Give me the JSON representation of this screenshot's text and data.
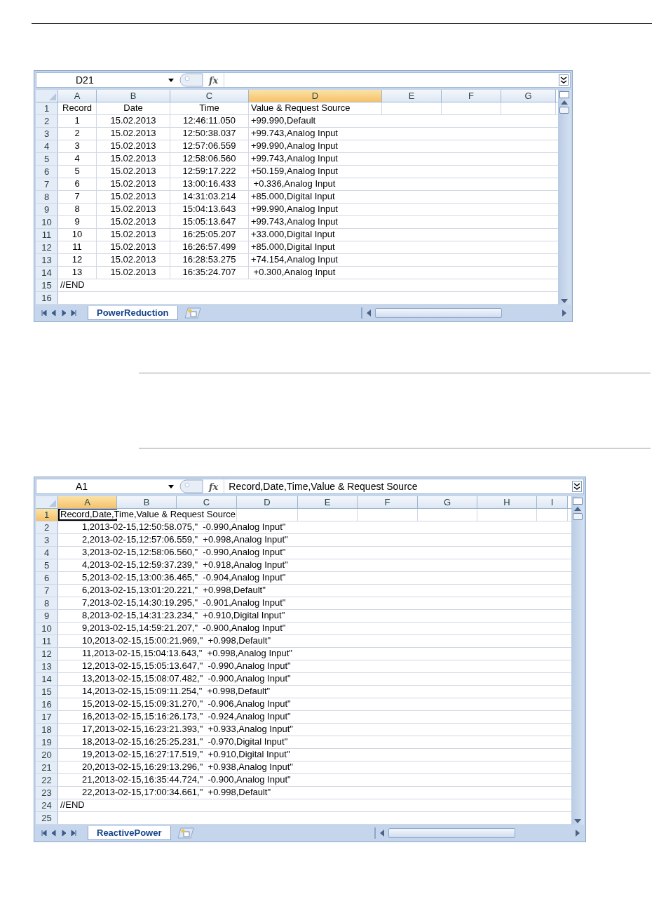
{
  "sheets": [
    {
      "name_box": "D21",
      "function_button": "fx",
      "tab": "PowerReduction",
      "columns": [
        {
          "label": "A",
          "selected": false
        },
        {
          "label": "B",
          "selected": false
        },
        {
          "label": "C",
          "selected": false
        },
        {
          "label": "D",
          "selected": true
        },
        {
          "label": "E",
          "selected": false
        },
        {
          "label": "F",
          "selected": false
        },
        {
          "label": "G",
          "selected": false
        }
      ],
      "rows": [
        {
          "number": "1",
          "kind": "header",
          "selected": false,
          "cells": [
            "Record",
            "Date",
            "Time",
            "Value & Request Source"
          ]
        },
        {
          "number": "2",
          "kind": "data",
          "selected": false,
          "cells": [
            "1",
            "15.02.2013",
            "12:46:11.050",
            "+99.990,Default"
          ]
        },
        {
          "number": "3",
          "kind": "data",
          "selected": false,
          "cells": [
            "2",
            "15.02.2013",
            "12:50:38.037",
            "+99.743,Analog Input"
          ]
        },
        {
          "number": "4",
          "kind": "data",
          "selected": false,
          "cells": [
            "3",
            "15.02.2013",
            "12:57:06.559",
            "+99.990,Analog Input"
          ]
        },
        {
          "number": "5",
          "kind": "data",
          "selected": false,
          "cells": [
            "4",
            "15.02.2013",
            "12:58:06.560",
            "+99.743,Analog Input"
          ]
        },
        {
          "number": "6",
          "kind": "data",
          "selected": false,
          "cells": [
            "5",
            "15.02.2013",
            "12:59:17.222",
            "+50.159,Analog Input"
          ]
        },
        {
          "number": "7",
          "kind": "data",
          "selected": false,
          "cells": [
            "6",
            "15.02.2013",
            "13:00:16.433",
            " +0.336,Analog Input"
          ]
        },
        {
          "number": "8",
          "kind": "data",
          "selected": false,
          "cells": [
            "7",
            "15.02.2013",
            "14:31:03.214",
            "+85.000,Digital Input"
          ]
        },
        {
          "number": "9",
          "kind": "data",
          "selected": false,
          "cells": [
            "8",
            "15.02.2013",
            "15:04:13.643",
            "+99.990,Analog Input"
          ]
        },
        {
          "number": "10",
          "kind": "data",
          "selected": false,
          "cells": [
            "9",
            "15.02.2013",
            "15:05:13.647",
            "+99.743,Analog Input"
          ]
        },
        {
          "number": "11",
          "kind": "data",
          "selected": false,
          "cells": [
            "10",
            "15.02.2013",
            "16:25:05.207",
            "+33.000,Digital Input"
          ]
        },
        {
          "number": "12",
          "kind": "data",
          "selected": false,
          "cells": [
            "11",
            "15.02.2013",
            "16:26:57.499",
            "+85.000,Digital Input"
          ]
        },
        {
          "number": "13",
          "kind": "data",
          "selected": false,
          "cells": [
            "12",
            "15.02.2013",
            "16:28:53.275",
            "+74.154,Analog Input"
          ]
        },
        {
          "number": "14",
          "kind": "data",
          "selected": false,
          "cells": [
            "13",
            "15.02.2013",
            "16:35:24.707",
            " +0.300,Analog Input"
          ]
        },
        {
          "number": "15",
          "kind": "marker",
          "selected": false,
          "cells": [
            "//END"
          ]
        },
        {
          "number": "16",
          "kind": "empty",
          "selected": false,
          "cells": []
        }
      ]
    },
    {
      "name_box": "A1",
      "function_button": "fx",
      "formula": "Record,Date,Time,Value & Request Source",
      "tab": "ReactivePower",
      "columns": [
        {
          "label": "A",
          "selected": true
        },
        {
          "label": "B",
          "selected": false
        },
        {
          "label": "C",
          "selected": false
        },
        {
          "label": "D",
          "selected": false
        },
        {
          "label": "E",
          "selected": false
        },
        {
          "label": "F",
          "selected": false
        },
        {
          "label": "G",
          "selected": false
        },
        {
          "label": "H",
          "selected": false
        },
        {
          "label": "I",
          "selected": false
        }
      ],
      "rows": [
        {
          "number": "1",
          "kind": "header",
          "selected": true,
          "cells": [
            "Record,Date,Time,Value & Request Source"
          ]
        },
        {
          "number": "2",
          "kind": "data",
          "selected": false,
          "cells": [
            "1,2013-02-15,12:50:58.075,\"  -0.990,Analog Input\""
          ]
        },
        {
          "number": "3",
          "kind": "data",
          "selected": false,
          "cells": [
            "2,2013-02-15,12:57:06.559,\"  +0.998,Analog Input\""
          ]
        },
        {
          "number": "4",
          "kind": "data",
          "selected": false,
          "cells": [
            "3,2013-02-15,12:58:06.560,\"  -0.990,Analog Input\""
          ]
        },
        {
          "number": "5",
          "kind": "data",
          "selected": false,
          "cells": [
            "4,2013-02-15,12:59:37.239,\"  +0.918,Analog Input\""
          ]
        },
        {
          "number": "6",
          "kind": "data",
          "selected": false,
          "cells": [
            "5,2013-02-15,13:00:36.465,\"  -0.904,Analog Input\""
          ]
        },
        {
          "number": "7",
          "kind": "data",
          "selected": false,
          "cells": [
            "6,2013-02-15,13:01:20.221,\"  +0.998,Default\""
          ]
        },
        {
          "number": "8",
          "kind": "data",
          "selected": false,
          "cells": [
            "7,2013-02-15,14:30:19.295,\"  -0.901,Analog Input\""
          ]
        },
        {
          "number": "9",
          "kind": "data",
          "selected": false,
          "cells": [
            "8,2013-02-15,14:31:23.234,\"  +0.910,Digital Input\""
          ]
        },
        {
          "number": "10",
          "kind": "data",
          "selected": false,
          "cells": [
            "9,2013-02-15,14:59:21.207,\"  -0.900,Analog Input\""
          ]
        },
        {
          "number": "11",
          "kind": "data",
          "selected": false,
          "cells": [
            "10,2013-02-15,15:00:21.969,\"  +0.998,Default\""
          ]
        },
        {
          "number": "12",
          "kind": "data",
          "selected": false,
          "cells": [
            "11,2013-02-15,15:04:13.643,\"  +0.998,Analog Input\""
          ]
        },
        {
          "number": "13",
          "kind": "data",
          "selected": false,
          "cells": [
            "12,2013-02-15,15:05:13.647,\"  -0.990,Analog Input\""
          ]
        },
        {
          "number": "14",
          "kind": "data",
          "selected": false,
          "cells": [
            "13,2013-02-15,15:08:07.482,\"  -0.900,Analog Input\""
          ]
        },
        {
          "number": "15",
          "kind": "data",
          "selected": false,
          "cells": [
            "14,2013-02-15,15:09:11.254,\"  +0.998,Default\""
          ]
        },
        {
          "number": "16",
          "kind": "data",
          "selected": false,
          "cells": [
            "15,2013-02-15,15:09:31.270,\"  -0.906,Analog Input\""
          ]
        },
        {
          "number": "17",
          "kind": "data",
          "selected": false,
          "cells": [
            "16,2013-02-15,15:16:26.173,\"  -0.924,Analog Input\""
          ]
        },
        {
          "number": "18",
          "kind": "data",
          "selected": false,
          "cells": [
            "17,2013-02-15,16:23:21.393,\"  +0.933,Analog Input\""
          ]
        },
        {
          "number": "19",
          "kind": "data",
          "selected": false,
          "cells": [
            "18,2013-02-15,16:25:25.231,\"  -0.970,Digital Input\""
          ]
        },
        {
          "number": "20",
          "kind": "data",
          "selected": false,
          "cells": [
            "19,2013-02-15,16:27:17.519,\"  +0.910,Digital Input\""
          ]
        },
        {
          "number": "21",
          "kind": "data",
          "selected": false,
          "cells": [
            "20,2013-02-15,16:29:13.296,\"  +0.938,Analog Input\""
          ]
        },
        {
          "number": "22",
          "kind": "data",
          "selected": false,
          "cells": [
            "21,2013-02-15,16:35:44.724,\"  -0.900,Analog Input\""
          ]
        },
        {
          "number": "23",
          "kind": "data",
          "selected": false,
          "cells": [
            "22,2013-02-15,17:00:34.661,\"  +0.998,Default\""
          ]
        },
        {
          "number": "24",
          "kind": "marker",
          "selected": false,
          "cells": [
            "//END"
          ]
        },
        {
          "number": "25",
          "kind": "empty",
          "selected": false,
          "cells": []
        }
      ]
    }
  ]
}
